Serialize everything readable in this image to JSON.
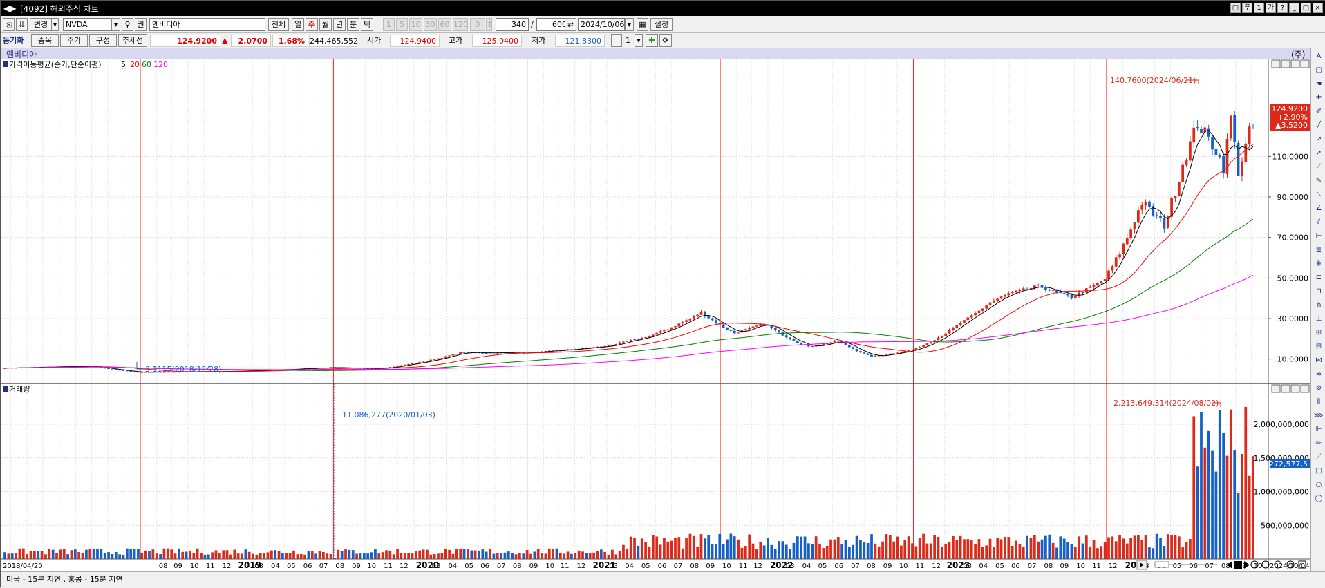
{
  "window": {
    "title": "[4092] 해외주식 차트",
    "title_buttons": [
      "□",
      "푸",
      "1",
      "가",
      "?",
      "_",
      "□",
      "×"
    ]
  },
  "toolbar": {
    "change_label": "변경",
    "symbol": "NVDA",
    "search_icon": "search-icon",
    "right_label": "권",
    "name": "엔비디아",
    "all_label": "전체",
    "periods": [
      "일",
      "주",
      "월",
      "년",
      "분",
      "틱"
    ],
    "active_period": "주",
    "minute_options": [
      "1",
      "5",
      "10",
      "30",
      "60",
      "120",
      "0"
    ],
    "count_display": "340",
    "count_total": "600",
    "date": "2024/10/06",
    "settings_label": "설정"
  },
  "toolbar2": {
    "sync_label": "동기화",
    "item_label": "종목",
    "period_label": "주기",
    "config_label": "구성",
    "trend_label": "추세선",
    "price": "124.9200",
    "change_arrow": "▲",
    "change": "2.0700",
    "change_pct": "1.68%",
    "volume": "244,465,552",
    "open_label": "시가",
    "open": "124.9400",
    "high_label": "고가",
    "high": "125.0400",
    "low_label": "저가",
    "low": "121.8300",
    "unit_value": "1"
  },
  "chart_header": {
    "name": "엔비디아",
    "unit": "(주)"
  },
  "price_panel": {
    "legend_label": "가격이동평균(종가,단순이평)",
    "ma_periods": [
      "5",
      "20",
      "60",
      "120"
    ],
    "ma_colors": [
      "#000000",
      "#ff0000",
      "#008000",
      "#ff00ff"
    ],
    "max_annotation": "140.7600(2024/06/21)",
    "min_annotation": "3.1115(2018/12/28)",
    "last_price_box": [
      "124.9200",
      "+2.90%",
      "▲3.5200"
    ]
  },
  "volume_panel": {
    "legend_label": "거래량",
    "max_annotation": "2,213,649,314(2024/08/02)",
    "min_annotation": "11,086,277(2020/01/03)",
    "last_volume_box": "1,272,577,5"
  },
  "x_axis": {
    "first_label": "2018/04/20",
    "last_label": "2024/10/04"
  },
  "status": {
    "text": "미국 - 15분 지연    , 홍콩 - 15분 지연"
  },
  "colors": {
    "up": "#dc2a1a",
    "down": "#1560c8",
    "accent": "#ff0000"
  },
  "chart_data": {
    "type": "candlestick",
    "title": "엔비디아",
    "interval": "weekly",
    "x_range": [
      "2018/04/20",
      "2024/10/04"
    ],
    "price_ylim": [
      0,
      150
    ],
    "price_yticks": [
      10,
      30,
      50,
      70,
      90,
      110
    ],
    "price_ytick_labels": [
      "10.0000",
      "30.0000",
      "50.0000",
      "70.0000",
      "90.0000",
      "110.0000"
    ],
    "volume_ylim": [
      0,
      2400000000
    ],
    "volume_yticks": [
      500000000,
      1000000000,
      1500000000,
      2000000000
    ],
    "volume_ytick_labels": [
      "500,000,000",
      "1,000,000,000",
      "1,500,000,000",
      "2,000,000,000"
    ],
    "year_markers": [
      "2019",
      "2020",
      "2021",
      "2022",
      "2023",
      "2024"
    ],
    "x_tick_labels": [
      "2018/04/20",
      "08",
      "09",
      "10",
      "11",
      "12",
      "2019",
      "03",
      "04",
      "05",
      "06",
      "07",
      "08",
      "09",
      "10",
      "11",
      "12",
      "2020",
      "03",
      "04",
      "05",
      "06",
      "07",
      "08",
      "09",
      "10",
      "11",
      "12",
      "2021",
      "03",
      "04",
      "05",
      "06",
      "07",
      "08",
      "09",
      "10",
      "11",
      "12",
      "2022",
      "03",
      "04",
      "05",
      "06",
      "07",
      "08",
      "09",
      "10",
      "11",
      "12",
      "2023",
      "03",
      "04",
      "05",
      "06",
      "07",
      "08",
      "09",
      "10",
      "11",
      "12",
      "2024",
      "03",
      "04",
      "05",
      "06",
      "07",
      "08",
      "09",
      "10",
      "2024/10/04"
    ],
    "price_anchors": [
      {
        "date": "2018-04-20",
        "close": 5.6
      },
      {
        "date": "2018-09-28",
        "close": 6.6
      },
      {
        "date": "2018-12-28",
        "close": 3.5
      },
      {
        "date": "2019-06-28",
        "close": 4.0
      },
      {
        "date": "2019-12-27",
        "close": 5.9
      },
      {
        "date": "2020-03-20",
        "close": 5.2
      },
      {
        "date": "2020-08-28",
        "close": 13.2
      },
      {
        "date": "2020-12-31",
        "close": 13.0
      },
      {
        "date": "2021-05-28",
        "close": 16.3
      },
      {
        "date": "2021-08-27",
        "close": 22.0
      },
      {
        "date": "2021-11-26",
        "close": 33.0
      },
      {
        "date": "2022-01-28",
        "close": 22.8
      },
      {
        "date": "2022-03-25",
        "close": 27.6
      },
      {
        "date": "2022-06-17",
        "close": 16.0
      },
      {
        "date": "2022-08-12",
        "close": 19.0
      },
      {
        "date": "2022-10-14",
        "close": 11.2
      },
      {
        "date": "2022-12-30",
        "close": 14.6
      },
      {
        "date": "2023-03-31",
        "close": 27.8
      },
      {
        "date": "2023-05-26",
        "close": 38.0
      },
      {
        "date": "2023-06-30",
        "close": 42.3
      },
      {
        "date": "2023-08-25",
        "close": 46.0
      },
      {
        "date": "2023-10-27",
        "close": 40.5
      },
      {
        "date": "2023-12-29",
        "close": 49.5
      },
      {
        "date": "2024-02-23",
        "close": 78.8
      },
      {
        "date": "2024-03-08",
        "close": 87.5
      },
      {
        "date": "2024-04-19",
        "close": 76.2
      },
      {
        "date": "2024-05-24",
        "close": 106.5
      },
      {
        "date": "2024-06-21",
        "close": 126.6
      },
      {
        "date": "2024-07-26",
        "close": 113.1
      },
      {
        "date": "2024-08-09",
        "close": 104.8
      },
      {
        "date": "2024-08-23",
        "close": 129.4
      },
      {
        "date": "2024-09-06",
        "close": 102.8
      },
      {
        "date": "2024-09-27",
        "close": 121.4
      },
      {
        "date": "2024-10-04",
        "close": 124.9
      }
    ],
    "moving_averages": [
      {
        "name": "5",
        "color": "#000000"
      },
      {
        "name": "20",
        "color": "#ff0000"
      },
      {
        "name": "60",
        "color": "#008000"
      },
      {
        "name": "120",
        "color": "#ff00ff"
      }
    ],
    "volume_regimes": [
      {
        "from": "2018-04-20",
        "to": "2021-06-30",
        "level": 110000000
      },
      {
        "from": "2021-07-01",
        "to": "2024-06-07",
        "level": 260000000
      },
      {
        "from": "2024-06-14",
        "to": "2024-10-04",
        "level": 1600000000
      }
    ],
    "volume_max": {
      "date": "2024-08-02",
      "value": 2213649314
    },
    "volume_min": {
      "date": "2020-01-03",
      "value": 11086277
    },
    "price_max": {
      "date": "2024-06-21",
      "value": 140.76
    },
    "price_min": {
      "date": "2018-12-28",
      "value": 3.1115
    }
  }
}
